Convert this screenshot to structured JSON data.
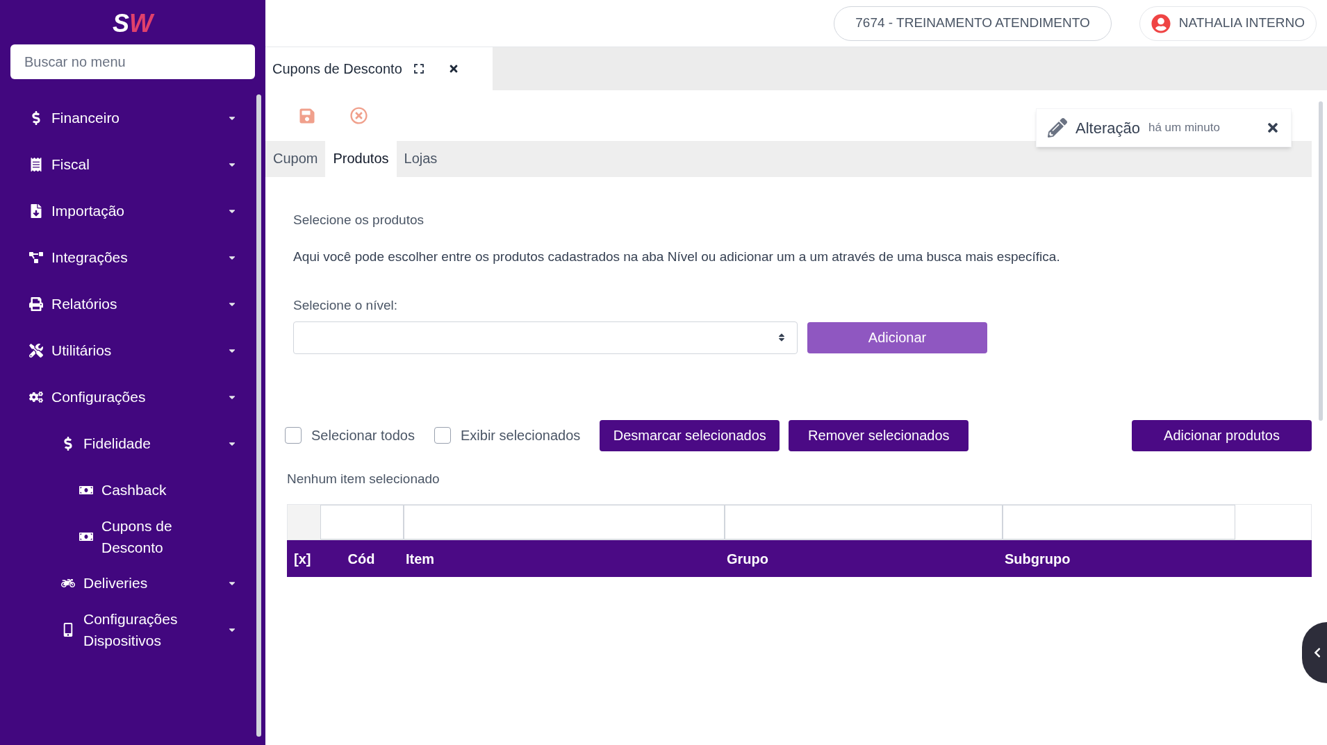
{
  "sidebar": {
    "logo": {
      "first": "S",
      "second": "W"
    },
    "search": {
      "placeholder": "Buscar no menu"
    },
    "items": [
      {
        "label": "Financeiro",
        "has_submenu": true
      },
      {
        "label": "Fiscal",
        "has_submenu": true
      },
      {
        "label": "Importação",
        "has_submenu": true
      },
      {
        "label": "Integrações",
        "has_submenu": true
      },
      {
        "label": "Relatórios",
        "has_submenu": true
      },
      {
        "label": "Utilitários",
        "has_submenu": true
      },
      {
        "label": "Configurações",
        "has_submenu": true,
        "children": [
          {
            "label": "Fidelidade",
            "has_submenu": true,
            "children": [
              {
                "label": "Cashback",
                "has_submenu": false
              },
              {
                "label": "Cupons de Desconto",
                "has_submenu": false
              }
            ]
          },
          {
            "label": "Deliveries",
            "has_submenu": true
          },
          {
            "label": "Configurações Dispositivos",
            "has_submenu": true
          }
        ]
      }
    ]
  },
  "header": {
    "company": "7674 - TREINAMENTO ATENDIMENTO",
    "user": "NATHALIA INTERNO"
  },
  "document_tab": {
    "title": "Cupons de Desconto"
  },
  "notification": {
    "title": "Alteração",
    "time": "há um minuto"
  },
  "tabs": [
    {
      "label": "Cupom",
      "selected": false
    },
    {
      "label": "Produtos",
      "selected": true
    },
    {
      "label": "Lojas",
      "selected": false
    }
  ],
  "content": {
    "heading": "Selecione os produtos",
    "description": "Aqui você pode escolher entre os produtos cadastrados na aba Nível ou adicionar um a um através de uma busca mais específica.",
    "level_label": "Selecione o nível:",
    "add_button": "Adicionar",
    "checkboxes": [
      {
        "label": "Selecionar todos",
        "checked": false
      },
      {
        "label": "Exibir selecionados",
        "checked": false
      }
    ],
    "actions": [
      "Desmarcar selecionados",
      "Remover selecionados"
    ],
    "add_products_button": "Adicionar produtos",
    "selection_status": "Nenhum item selecionado"
  },
  "table": {
    "columns": [
      "[x]",
      "Cód",
      "Item",
      "Grupo",
      "Subgrupo"
    ]
  }
}
